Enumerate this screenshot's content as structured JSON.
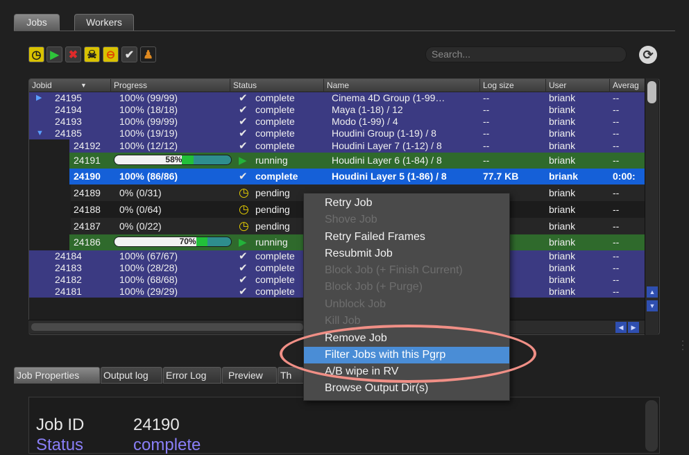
{
  "top_tabs": [
    {
      "label": "Jobs",
      "active": true
    },
    {
      "label": "Workers",
      "active": false
    }
  ],
  "toolbar": {
    "buttons": [
      {
        "icon": "clock-icon",
        "glyph": "◷",
        "bg": "#d9c200",
        "fg": "#1a1a1a"
      },
      {
        "icon": "play-icon",
        "glyph": "▶",
        "bg": "#3a3a3a",
        "fg": "#2ec43a"
      },
      {
        "icon": "kill-x-icon",
        "glyph": "✖",
        "bg": "#3a3a3a",
        "fg": "#e02a2a"
      },
      {
        "icon": "skull-icon",
        "glyph": "☠",
        "bg": "#d9c200",
        "fg": "#1a1a1a"
      },
      {
        "icon": "block-icon",
        "glyph": "⊖",
        "bg": "#d9c200",
        "fg": "#e04a00"
      },
      {
        "icon": "checkmark-icon",
        "glyph": "✔",
        "bg": "#3a3a3a",
        "fg": "#e0e0e0"
      },
      {
        "icon": "user-icon",
        "glyph": "♟",
        "bg": "#202020",
        "fg": "#e08a20"
      }
    ],
    "search_placeholder": "Search...",
    "refresh_icon": "refresh-icon"
  },
  "table": {
    "columns": [
      "Jobid",
      "Progress",
      "Status",
      "Name",
      "Log size",
      "User",
      "Averag"
    ],
    "rows": [
      {
        "jobid": "24195",
        "progress": "100% (99/99)",
        "status": "complete",
        "name": "Cinema 4D Group (1-99…",
        "logsize": "--",
        "user": "briank",
        "avg": "--"
      },
      {
        "jobid": "24194",
        "progress": "100% (18/18)",
        "status": "complete",
        "name": "Maya  (1-18) / 12",
        "logsize": "--",
        "user": "briank",
        "avg": "--"
      },
      {
        "jobid": "24193",
        "progress": "100% (99/99)",
        "status": "complete",
        "name": "Modo  (1-99) / 4",
        "logsize": "--",
        "user": "briank",
        "avg": "--"
      },
      {
        "jobid": "24185",
        "progress": "100% (19/19)",
        "status": "complete",
        "name": "Houdini Group (1-19) / 8",
        "logsize": "--",
        "user": "briank",
        "avg": "--"
      },
      {
        "jobid": "24192",
        "progress": "100% (12/12)",
        "status": "complete",
        "name": "Houdini Layer 7 (1-12) / 8",
        "logsize": "--",
        "user": "briank",
        "avg": "--"
      },
      {
        "jobid": "24191",
        "progress": "58%",
        "progress_value": 0.58,
        "status": "running",
        "name": "Houdini Layer 6 (1-84) / 8",
        "logsize": "--",
        "user": "briank",
        "avg": "--"
      },
      {
        "jobid": "24190",
        "progress": "100% (86/86)",
        "status": "complete",
        "name": "Houdini Layer 5 (1-86) / 8",
        "logsize": "77.7 KB",
        "user": "briank",
        "avg": "0:00:"
      },
      {
        "jobid": "24189",
        "progress": "0% (0/31)",
        "status": "pending",
        "name": "",
        "logsize": "",
        "user": "briank",
        "avg": "--"
      },
      {
        "jobid": "24188",
        "progress": "0% (0/64)",
        "status": "pending",
        "name": "",
        "logsize": "",
        "user": "briank",
        "avg": "--"
      },
      {
        "jobid": "24187",
        "progress": "0% (0/22)",
        "status": "pending",
        "name": "",
        "logsize": "",
        "user": "briank",
        "avg": "--"
      },
      {
        "jobid": "24186",
        "progress": "70%",
        "progress_value": 0.7,
        "status": "running",
        "name": "",
        "logsize": "",
        "user": "briank",
        "avg": "--"
      },
      {
        "jobid": "24184",
        "progress": "100% (67/67)",
        "status": "complete",
        "name": "",
        "logsize": "",
        "user": "briank",
        "avg": "--"
      },
      {
        "jobid": "24183",
        "progress": "100% (28/28)",
        "status": "complete",
        "name": "",
        "logsize": "",
        "user": "briank",
        "avg": "--"
      },
      {
        "jobid": "24182",
        "progress": "100% (68/68)",
        "status": "complete",
        "name": "",
        "logsize": "",
        "user": "briank",
        "avg": "--"
      },
      {
        "jobid": "24181",
        "progress": "100% (29/29)",
        "status": "complete",
        "name": "",
        "logsize": "",
        "user": "briank",
        "avg": "--"
      }
    ]
  },
  "status_icons": {
    "complete": {
      "icon": "checkmark-icon",
      "glyph": "✔",
      "color": "#e8e8e8"
    },
    "running": {
      "icon": "play-icon",
      "glyph": "▶",
      "color": "#23b23a"
    },
    "pending": {
      "icon": "clock-icon",
      "glyph": "◷",
      "color": "#e8d000"
    }
  },
  "row_colors": {
    "complete": "#3b3a82",
    "running": "#2f6a2c",
    "pending": "#1f1f1f",
    "selected": "#1560d8"
  },
  "context_menu": {
    "items": [
      {
        "label": "Retry Job",
        "enabled": true
      },
      {
        "label": "Shove Job",
        "enabled": false
      },
      {
        "label": "Retry Failed Frames",
        "enabled": true
      },
      {
        "label": "Resubmit Job",
        "enabled": true
      },
      {
        "label": "Block Job (+ Finish Current)",
        "enabled": false
      },
      {
        "label": "Block Job (+ Purge)",
        "enabled": false
      },
      {
        "label": "Unblock Job",
        "enabled": false
      },
      {
        "label": "Kill Job",
        "enabled": false
      },
      {
        "label": "Remove Job",
        "enabled": true
      },
      {
        "label": "Filter Jobs with this Pgrp",
        "enabled": true,
        "highlighted": true
      },
      {
        "label": "A/B wipe in RV",
        "enabled": true
      },
      {
        "label": "Browse Output Dir(s)",
        "enabled": true
      }
    ]
  },
  "bottom_tabs": [
    {
      "label": "Job Properties",
      "active": true
    },
    {
      "label": "Output log",
      "active": false
    },
    {
      "label": "Error Log",
      "active": false
    },
    {
      "label": "Preview",
      "active": false
    },
    {
      "label": "Th",
      "active": false
    }
  ],
  "properties": [
    {
      "key": "Job ID",
      "value": "24190",
      "color": "#ffffff"
    },
    {
      "key": "Status",
      "value": "complete",
      "color": "#8a7ff7"
    }
  ],
  "scroll_icons": [
    "scroll-up-icon",
    "scroll-down-icon",
    "scroll-left-icon",
    "scroll-right-icon"
  ]
}
